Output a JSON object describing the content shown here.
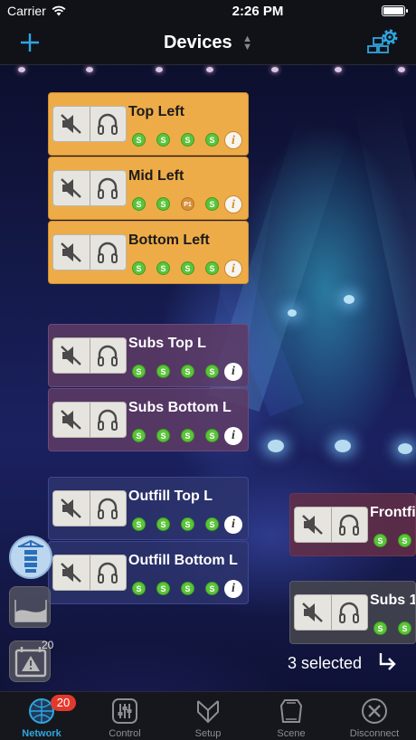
{
  "status_bar": {
    "carrier": "Carrier",
    "time": "2:26 PM"
  },
  "nav": {
    "title": "Devices"
  },
  "devices": [
    {
      "name": "Top Left",
      "badges": [
        "S",
        "S",
        "S",
        "S"
      ],
      "info": "i"
    },
    {
      "name": "Mid Left",
      "badges": [
        "S",
        "S",
        "P1",
        "S"
      ],
      "info": "i"
    },
    {
      "name": "Bottom Left",
      "badges": [
        "S",
        "S",
        "S",
        "S"
      ],
      "info": "i"
    },
    {
      "name": "Subs Top L",
      "badges": [
        "S",
        "S",
        "S",
        "S"
      ],
      "info": "i"
    },
    {
      "name": "Subs Bottom L",
      "badges": [
        "S",
        "S",
        "S",
        "S"
      ],
      "info": "i"
    },
    {
      "name": "Outfill Top L",
      "badges": [
        "S",
        "S",
        "S",
        "S"
      ],
      "info": "i"
    },
    {
      "name": "Outfill Bottom L",
      "badges": [
        "S",
        "S",
        "S",
        "S"
      ],
      "info": "i"
    },
    {
      "name": "Frontfi",
      "badges": [
        "S",
        "S"
      ]
    },
    {
      "name": "Subs 1",
      "badges": [
        "S",
        "S"
      ]
    }
  ],
  "alerts": {
    "count": "20"
  },
  "selection": {
    "text": "3 selected"
  },
  "tabs": [
    {
      "label": "Network",
      "badge": "20",
      "active": true,
      "icon": "network-globe-icon"
    },
    {
      "label": "Control",
      "icon": "control-faders-icon"
    },
    {
      "label": "Setup",
      "icon": "setup-array-icon"
    },
    {
      "label": "Scene",
      "icon": "scene-icon"
    },
    {
      "label": "Disconnect",
      "icon": "disconnect-icon"
    }
  ],
  "colors": {
    "accent": "#2fa6e0",
    "group_orange": "#eeac48",
    "group_purple": "#5c3a64",
    "group_blue": "#2d346e",
    "group_red": "#642e46",
    "status_green": "#5bc43a",
    "status_preset": "#d69038",
    "badge_red": "#e3392c"
  }
}
